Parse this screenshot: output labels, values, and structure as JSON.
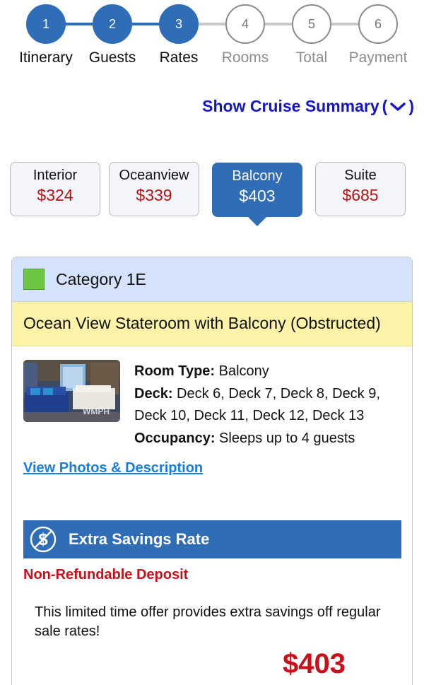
{
  "stepper": {
    "steps": [
      {
        "number": "1",
        "label": "Itinerary",
        "state": "done"
      },
      {
        "number": "2",
        "label": "Guests",
        "state": "done"
      },
      {
        "number": "3",
        "label": "Rates",
        "state": "done"
      },
      {
        "number": "4",
        "label": "Rooms",
        "state": "todo"
      },
      {
        "number": "5",
        "label": "Total",
        "state": "todo"
      },
      {
        "number": "6",
        "label": "Payment",
        "state": "todo"
      }
    ]
  },
  "summary": {
    "label": "Show Cruise Summary",
    "open_paren": "(",
    "close_paren": ")"
  },
  "tabs": [
    {
      "name": "Interior",
      "price": "$324",
      "active": false
    },
    {
      "name": "Oceanview",
      "price": "$339",
      "active": false
    },
    {
      "name": "Balcony",
      "price": "$403",
      "active": true
    },
    {
      "name": "Suite",
      "price": "$685",
      "active": false
    }
  ],
  "card": {
    "category": "Category 1E",
    "swatch_color": "#6cc644",
    "room_name": "Ocean View Stateroom with Balcony (Obstructed)",
    "room_type_label": "Room Type:",
    "room_type_value": " Balcony",
    "deck_label": "Deck:",
    "deck_value": " Deck 6, Deck 7, Deck 8, Deck 9, Deck 10, Deck 11, Deck 12, Deck 13",
    "occupancy_label": "Occupancy:",
    "occupancy_value": " Sleeps up to 4 guests",
    "view_link": "View Photos & Description",
    "rate_title": "Extra Savings Rate",
    "deposit": "Non-Refundable Deposit",
    "offer": "This limited time offer provides extra savings off regular sale rates!",
    "price": "$403"
  },
  "colors": {
    "accent": "#2f6db6",
    "price_red": "#b31414",
    "link_blue": "#1414c8"
  }
}
